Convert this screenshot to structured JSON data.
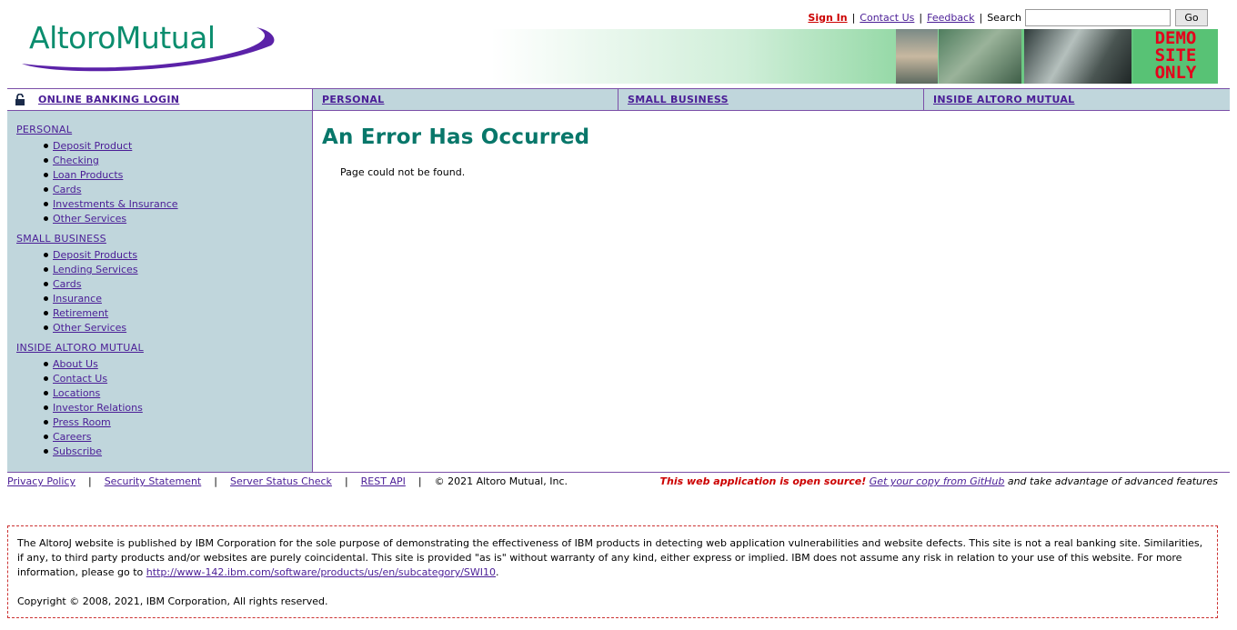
{
  "brand": {
    "logo_bold": "Altoro",
    "logo_light": "Mutual"
  },
  "top_links": {
    "sign_in": "Sign In",
    "contact_us": "Contact Us",
    "feedback": "Feedback",
    "search_label": "Search",
    "search_value": "",
    "go_label": "Go",
    "separator": "|"
  },
  "banner": {
    "demo_lines": [
      "DEMO",
      "SITE",
      "ONLY"
    ]
  },
  "nav": {
    "login": "ONLINE BANKING LOGIN",
    "personal": "PERSONAL",
    "small_business": "SMALL BUSINESS",
    "inside": "INSIDE ALTORO MUTUAL"
  },
  "sidebar": {
    "sections": [
      {
        "heading": "PERSONAL",
        "items": [
          "Deposit Product",
          "Checking",
          "Loan Products",
          "Cards",
          "Investments & Insurance",
          "Other Services"
        ]
      },
      {
        "heading": "SMALL BUSINESS",
        "items": [
          "Deposit Products",
          "Lending Services",
          "Cards",
          "Insurance",
          "Retirement",
          "Other Services"
        ]
      },
      {
        "heading": "INSIDE ALTORO MUTUAL",
        "items": [
          "About Us",
          "Contact Us",
          "Locations",
          "Investor Relations",
          "Press Room",
          "Careers",
          "Subscribe"
        ]
      }
    ]
  },
  "main": {
    "title": "An Error Has Occurred",
    "message": "Page could not be found."
  },
  "footer": {
    "privacy": "Privacy Policy",
    "security": "Security Statement",
    "server_status": "Server Status Check",
    "rest_api": "REST API",
    "copyright": "© 2021 Altoro Mutual, Inc.",
    "separator": "|",
    "open_source_red": "This web application is open source!",
    "github_link": "Get your copy from GitHub",
    "open_source_tail": "and take advantage of advanced features"
  },
  "disclaimer": {
    "text_before_link": "The AltoroJ website is published by IBM Corporation for the sole purpose of demonstrating the effectiveness of IBM products in detecting web application vulnerabilities and website defects. This site is not a real banking site. Similarities, if any, to third party products and/or websites are purely coincidental. This site is provided \"as is\" without warranty of any kind, either express or implied. IBM does not assume any risk in relation to your use of this website. For more information, please go to",
    "link": "http://www-142.ibm.com/software/products/us/en/subcategory/SWI10",
    "text_after_link": ".",
    "copyright": "Copyright © 2008, 2021, IBM Corporation, All rights reserved."
  },
  "colors": {
    "accent_purple": "#4a1d96",
    "title_teal": "#08776a",
    "sidebar_bg": "#c0d6dc",
    "sign_in_red": "#cc0000",
    "demo_green": "#58c275"
  },
  "icons": [
    "lock-icon",
    "logo-swoosh"
  ]
}
